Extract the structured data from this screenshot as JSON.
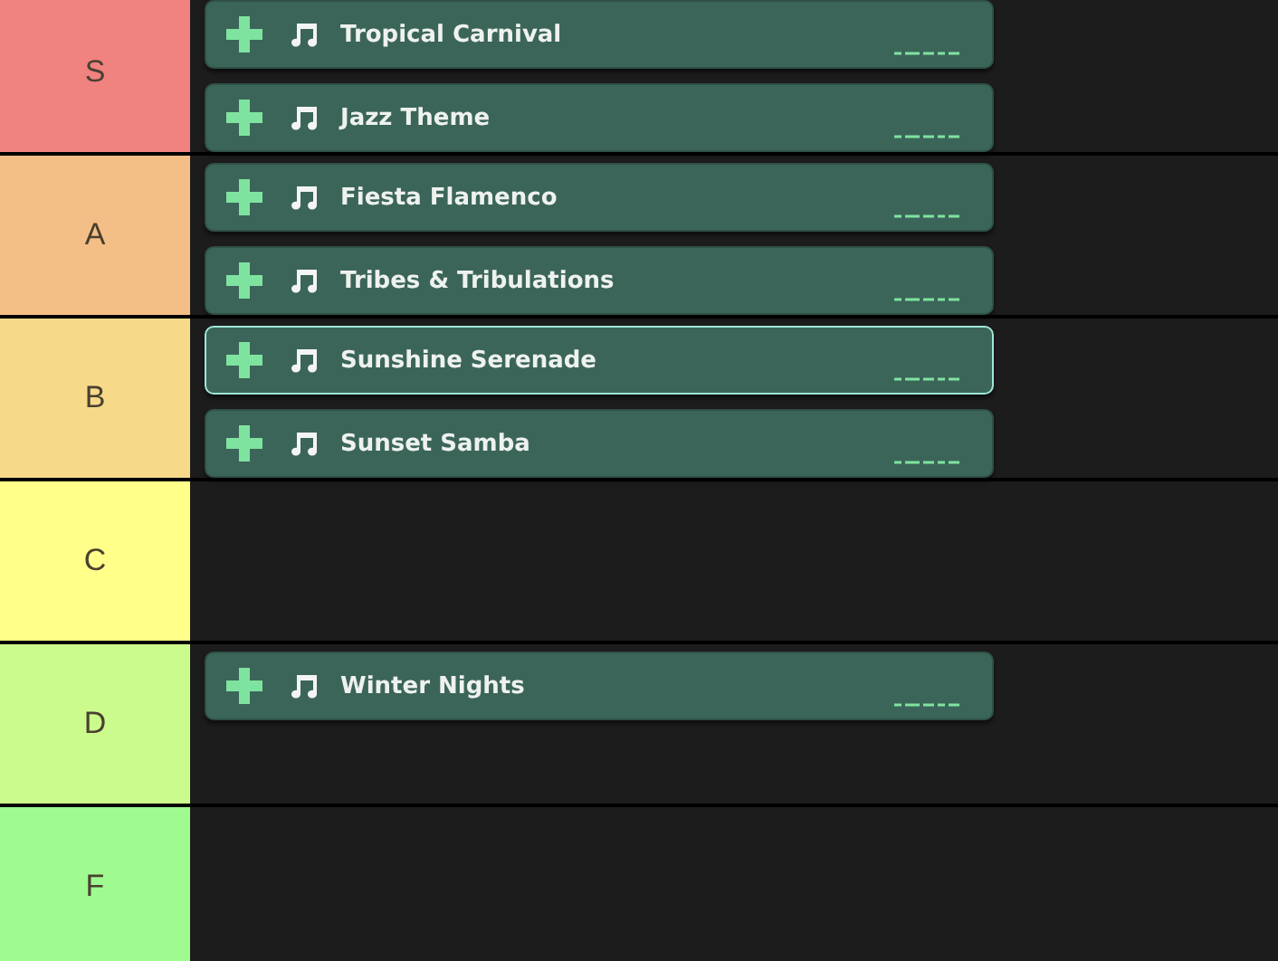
{
  "tiers": [
    {
      "label": "S",
      "color": "#f08280",
      "songs": [
        {
          "title": "Tropical Carnival",
          "selected": false
        },
        {
          "title": "Jazz Theme",
          "selected": false
        }
      ]
    },
    {
      "label": "A",
      "color": "#f4bf86",
      "songs": [
        {
          "title": "Fiesta Flamenco",
          "selected": false
        },
        {
          "title": "Tribes & Tribulations",
          "selected": false
        }
      ]
    },
    {
      "label": "B",
      "color": "#f6da8a",
      "songs": [
        {
          "title": "Sunshine Serenade",
          "selected": true
        },
        {
          "title": "Sunset Samba",
          "selected": false
        }
      ]
    },
    {
      "label": "C",
      "color": "#ffff8a"
    },
    {
      "label": "D",
      "color": "#ccfb8d",
      "songs": [
        {
          "title": "Winter Nights",
          "selected": false
        }
      ]
    },
    {
      "label": "F",
      "color": "#9ffa90"
    }
  ]
}
